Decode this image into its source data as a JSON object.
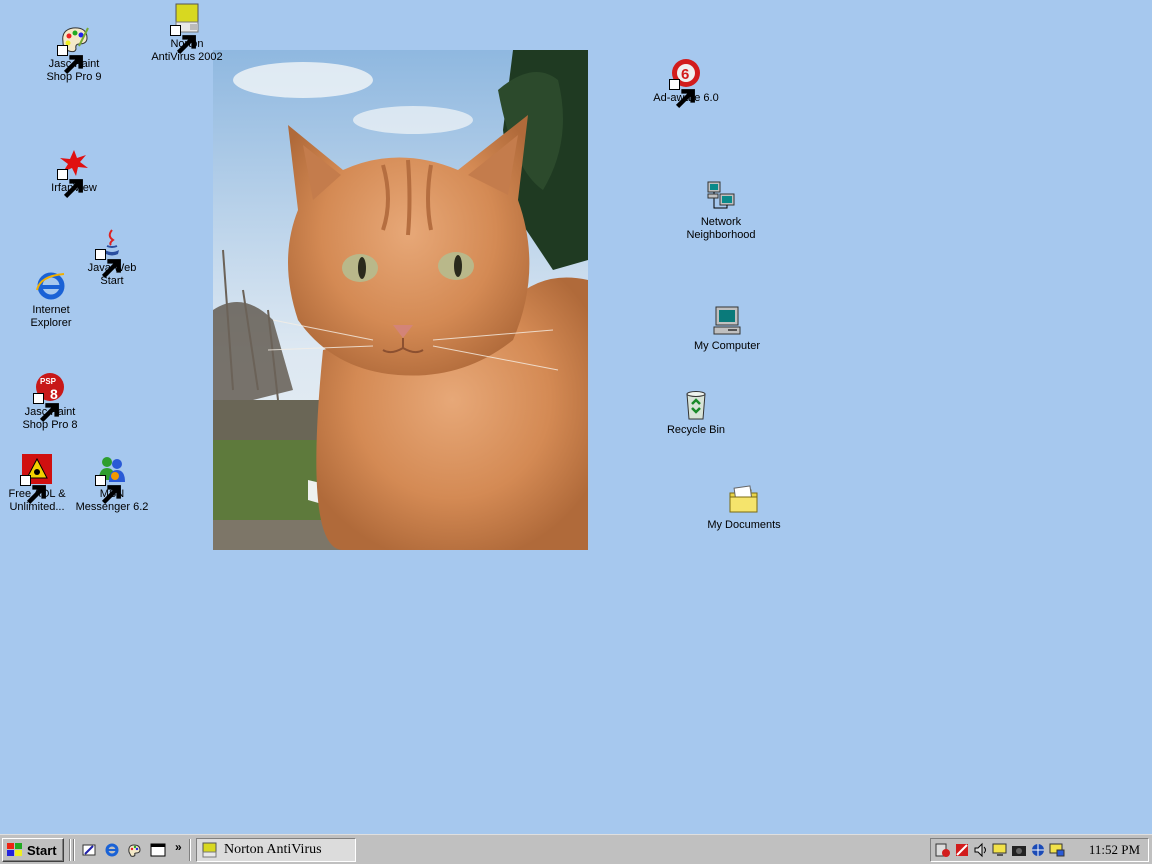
{
  "desktop": {
    "icons": [
      {
        "label": "Jasc Paint\nShop Pro 9"
      },
      {
        "label": "Norton\nAntiVirus 2002"
      },
      {
        "label": "IrfanView"
      },
      {
        "label": "Java Web\nStart"
      },
      {
        "label": "Internet\nExplorer"
      },
      {
        "label": "Jasc Paint\nShop Pro 8"
      },
      {
        "label": "Free AOL &\nUnlimited..."
      },
      {
        "label": "MSN\nMessenger 6.2"
      },
      {
        "label": "Ad-aware 6.0"
      },
      {
        "label": "Network\nNeighborhood"
      },
      {
        "label": "My Computer"
      },
      {
        "label": "Recycle Bin"
      },
      {
        "label": "My Documents"
      }
    ],
    "background_color": "#a6c8ee"
  },
  "taskbar": {
    "start_label": "Start",
    "quick_launch": [
      "show-desktop-icon",
      "internet-explorer-icon",
      "paint-shop-icon",
      "window-icon"
    ],
    "overflow_label": "»",
    "task_label": "Norton AntiVirus",
    "tray_icons": [
      "norton-icon",
      "adaware-icon",
      "volume-icon",
      "monitor-icon",
      "camera-icon",
      "network-icon",
      "display-icon"
    ],
    "clock": "11:52 PM"
  }
}
